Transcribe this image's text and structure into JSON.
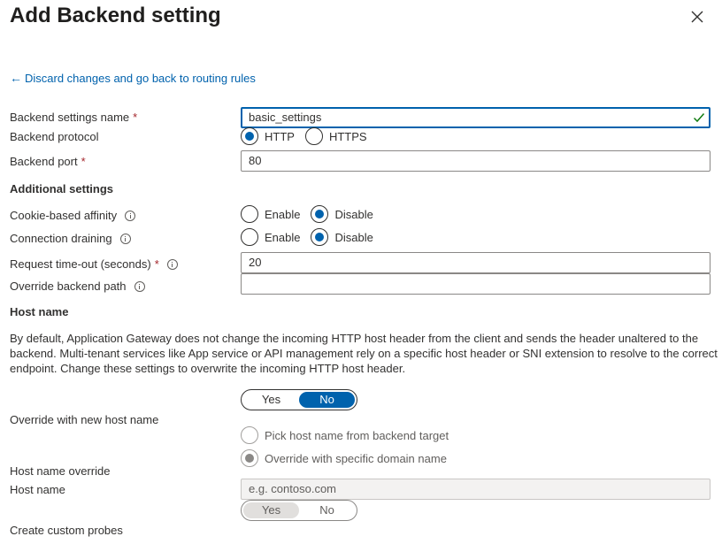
{
  "header": {
    "title": "Add Backend setting",
    "close_icon": "close-icon"
  },
  "back_link": {
    "arrow": "←",
    "label": "Discard changes and go back to routing rules"
  },
  "fields": {
    "settings_name": {
      "label": "Backend settings name",
      "required": "*",
      "value": "basic_settings"
    },
    "protocol": {
      "label": "Backend protocol",
      "options": [
        "HTTP",
        "HTTPS"
      ],
      "selected": "HTTP"
    },
    "port": {
      "label": "Backend port",
      "required": "*",
      "value": "80"
    }
  },
  "additional": {
    "heading": "Additional settings",
    "cookie_affinity": {
      "label": "Cookie-based affinity",
      "options": [
        "Enable",
        "Disable"
      ],
      "selected": "Disable"
    },
    "connection_draining": {
      "label": "Connection draining",
      "options": [
        "Enable",
        "Disable"
      ],
      "selected": "Disable"
    },
    "request_timeout": {
      "label": "Request time-out (seconds)",
      "required": "*",
      "value": "20"
    },
    "override_path": {
      "label": "Override backend path",
      "value": ""
    }
  },
  "host": {
    "heading": "Host name",
    "description": "By default, Application Gateway does not change the incoming HTTP host header from the client and sends the header unaltered to the backend. Multi-tenant services like App service or API management rely on a specific host header or SNI extension to resolve to the correct endpoint. Change these settings to overwrite the incoming HTTP host header.",
    "override_new": {
      "label": "Override with new host name",
      "options": [
        "Yes",
        "No"
      ],
      "selected": "No"
    },
    "pick_option": "Pick host name from backend target",
    "specific_option": "Override with specific domain name",
    "host_override_label": "Host name override",
    "host_name": {
      "label": "Host name",
      "placeholder": "e.g. contoso.com"
    },
    "custom_probes": {
      "label": "Create custom probes",
      "options": [
        "Yes",
        "No"
      ],
      "selected": "Yes"
    }
  },
  "colors": {
    "accent": "#0062ad",
    "required": "#a4262c",
    "text": "#323130"
  }
}
